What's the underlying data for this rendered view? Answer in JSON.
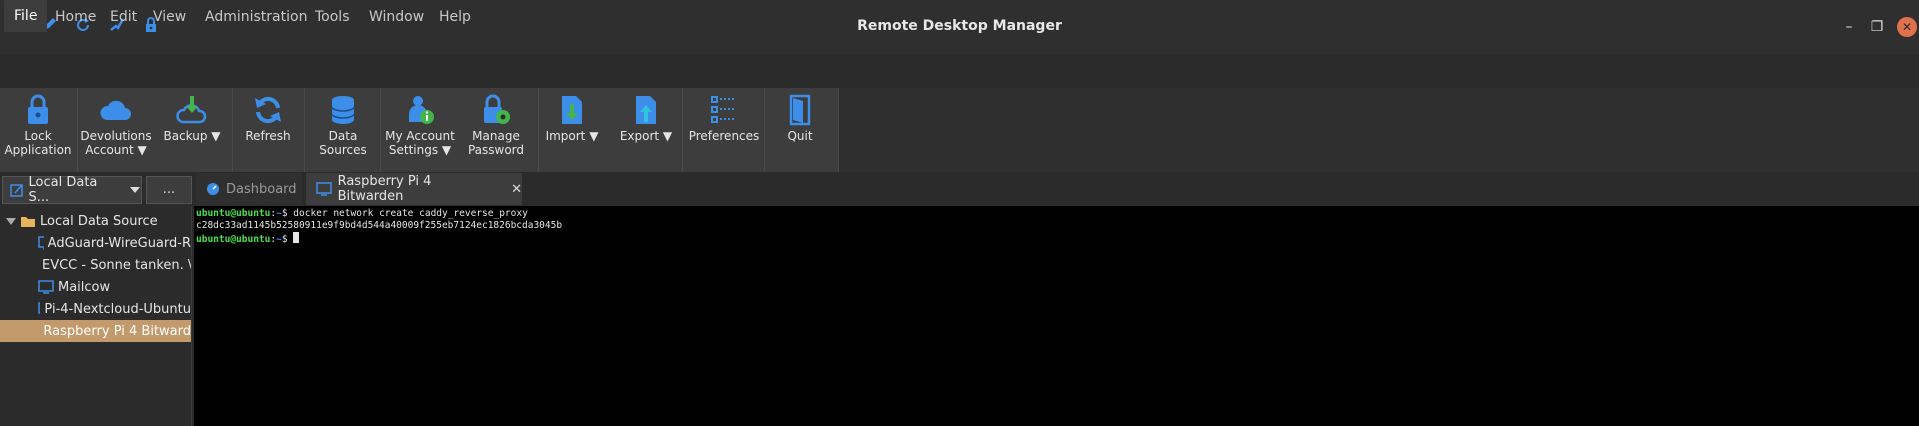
{
  "window": {
    "title": "Remote Desktop Manager"
  },
  "quick_access": [
    "add-icon",
    "edit-icon",
    "refresh-icon",
    "check-icon",
    "lock-icon"
  ],
  "menu": [
    "File",
    "Home",
    "Edit",
    "View",
    "Administration",
    "Tools",
    "Window",
    "Help"
  ],
  "ribbon": {
    "lock": {
      "line1": "Lock",
      "line2": "Application"
    },
    "devolutions": {
      "line1": "Devolutions",
      "line2": "Account ▼"
    },
    "backup": {
      "line1": "Backup ▼"
    },
    "refresh": {
      "line1": "Refresh"
    },
    "data_sources": {
      "line1": "Data",
      "line2": "Sources"
    },
    "my_account": {
      "line1": "My Account",
      "line2": "Settings ▼"
    },
    "manage_password": {
      "line1": "Manage",
      "line2": "Password"
    },
    "import": {
      "line1": "Import ▼"
    },
    "export": {
      "line1": "Export ▼"
    },
    "preferences": {
      "line1": "Preferences"
    },
    "quit": {
      "line1": "Quit"
    }
  },
  "datasource": {
    "selected": "Local Data S...",
    "more": "..."
  },
  "tabs": {
    "dashboard": "Dashboard",
    "active": "Raspberry Pi 4 Bitwarden"
  },
  "tree": {
    "root": "Local Data Source",
    "items": [
      "AdGuard-WireGuard-R",
      "EVCC - Sonne tanken. \\",
      "Mailcow",
      "Pi-4-Nextcloud-Ubuntu",
      "Raspberry Pi 4 Bitward"
    ]
  },
  "terminal": {
    "prompt_user": "ubuntu@ubuntu",
    "prompt_sep": ":",
    "prompt_path": "~",
    "prompt_end": "$",
    "command": "docker network create caddy_reverse_proxy",
    "output": "c28dc33ad1145b52580911e9f9bd4d544a40009f255eb7124ec1826bcda3045b"
  },
  "colors": {
    "accent": "#3d8ee8",
    "selection": "#c29a6b",
    "terminal_bg": "#000000",
    "close": "#e0714d"
  }
}
